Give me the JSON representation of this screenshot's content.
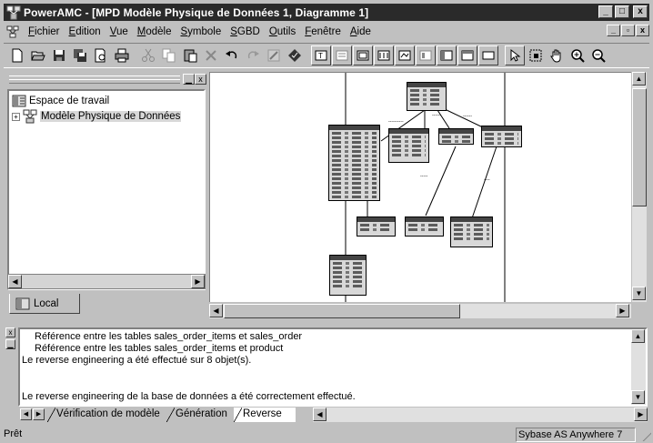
{
  "window": {
    "title": "PowerAMC - [MPD Modèle Physique de Données 1, Diagramme 1]",
    "controls": [
      "_",
      "□",
      "x"
    ],
    "mdi_controls": [
      "_",
      "▫",
      "x"
    ]
  },
  "menu": [
    "Fichier",
    "Edition",
    "Vue",
    "Modèle",
    "Symbole",
    "SGBD",
    "Outils",
    "Fenêtre",
    "Aide"
  ],
  "toolbar": {
    "buttons": [
      "new-icon",
      "open-icon",
      "save-icon",
      "save-all-icon",
      "print-preview-icon",
      "print-icon",
      "cut-icon",
      "copy-icon",
      "paste-icon",
      "delete-icon",
      "undo-icon",
      "redo-icon",
      "properties-icon",
      "model-check-icon",
      "view-1-icon",
      "view-2-icon",
      "view-3-icon",
      "view-4-icon",
      "view-5-icon",
      "view-6-icon",
      "view-7-icon",
      "view-8-icon",
      "view-9-icon",
      "pointer-icon",
      "lasso-icon",
      "hand-icon",
      "zoom-in-icon",
      "zoom-out-icon"
    ]
  },
  "browser": {
    "root": "Espace de travail",
    "child": "Modèle Physique de Données",
    "tab": "Local"
  },
  "output": {
    "lines": [
      "Référence entre les tables sales_order_items et sales_order",
      "Référence entre les tables sales_order_items et product",
      "Le reverse engineering a été effectué sur  8 objet(s).",
      "",
      "Le reverse engineering de la base de données a été correctement effectué."
    ],
    "tabs": [
      "Vérification de modèle",
      "Génération",
      "Reverse"
    ],
    "active_tab": "Reverse"
  },
  "status": {
    "main": "Prêt",
    "dbms": "Sybase AS Anywhere 7"
  }
}
